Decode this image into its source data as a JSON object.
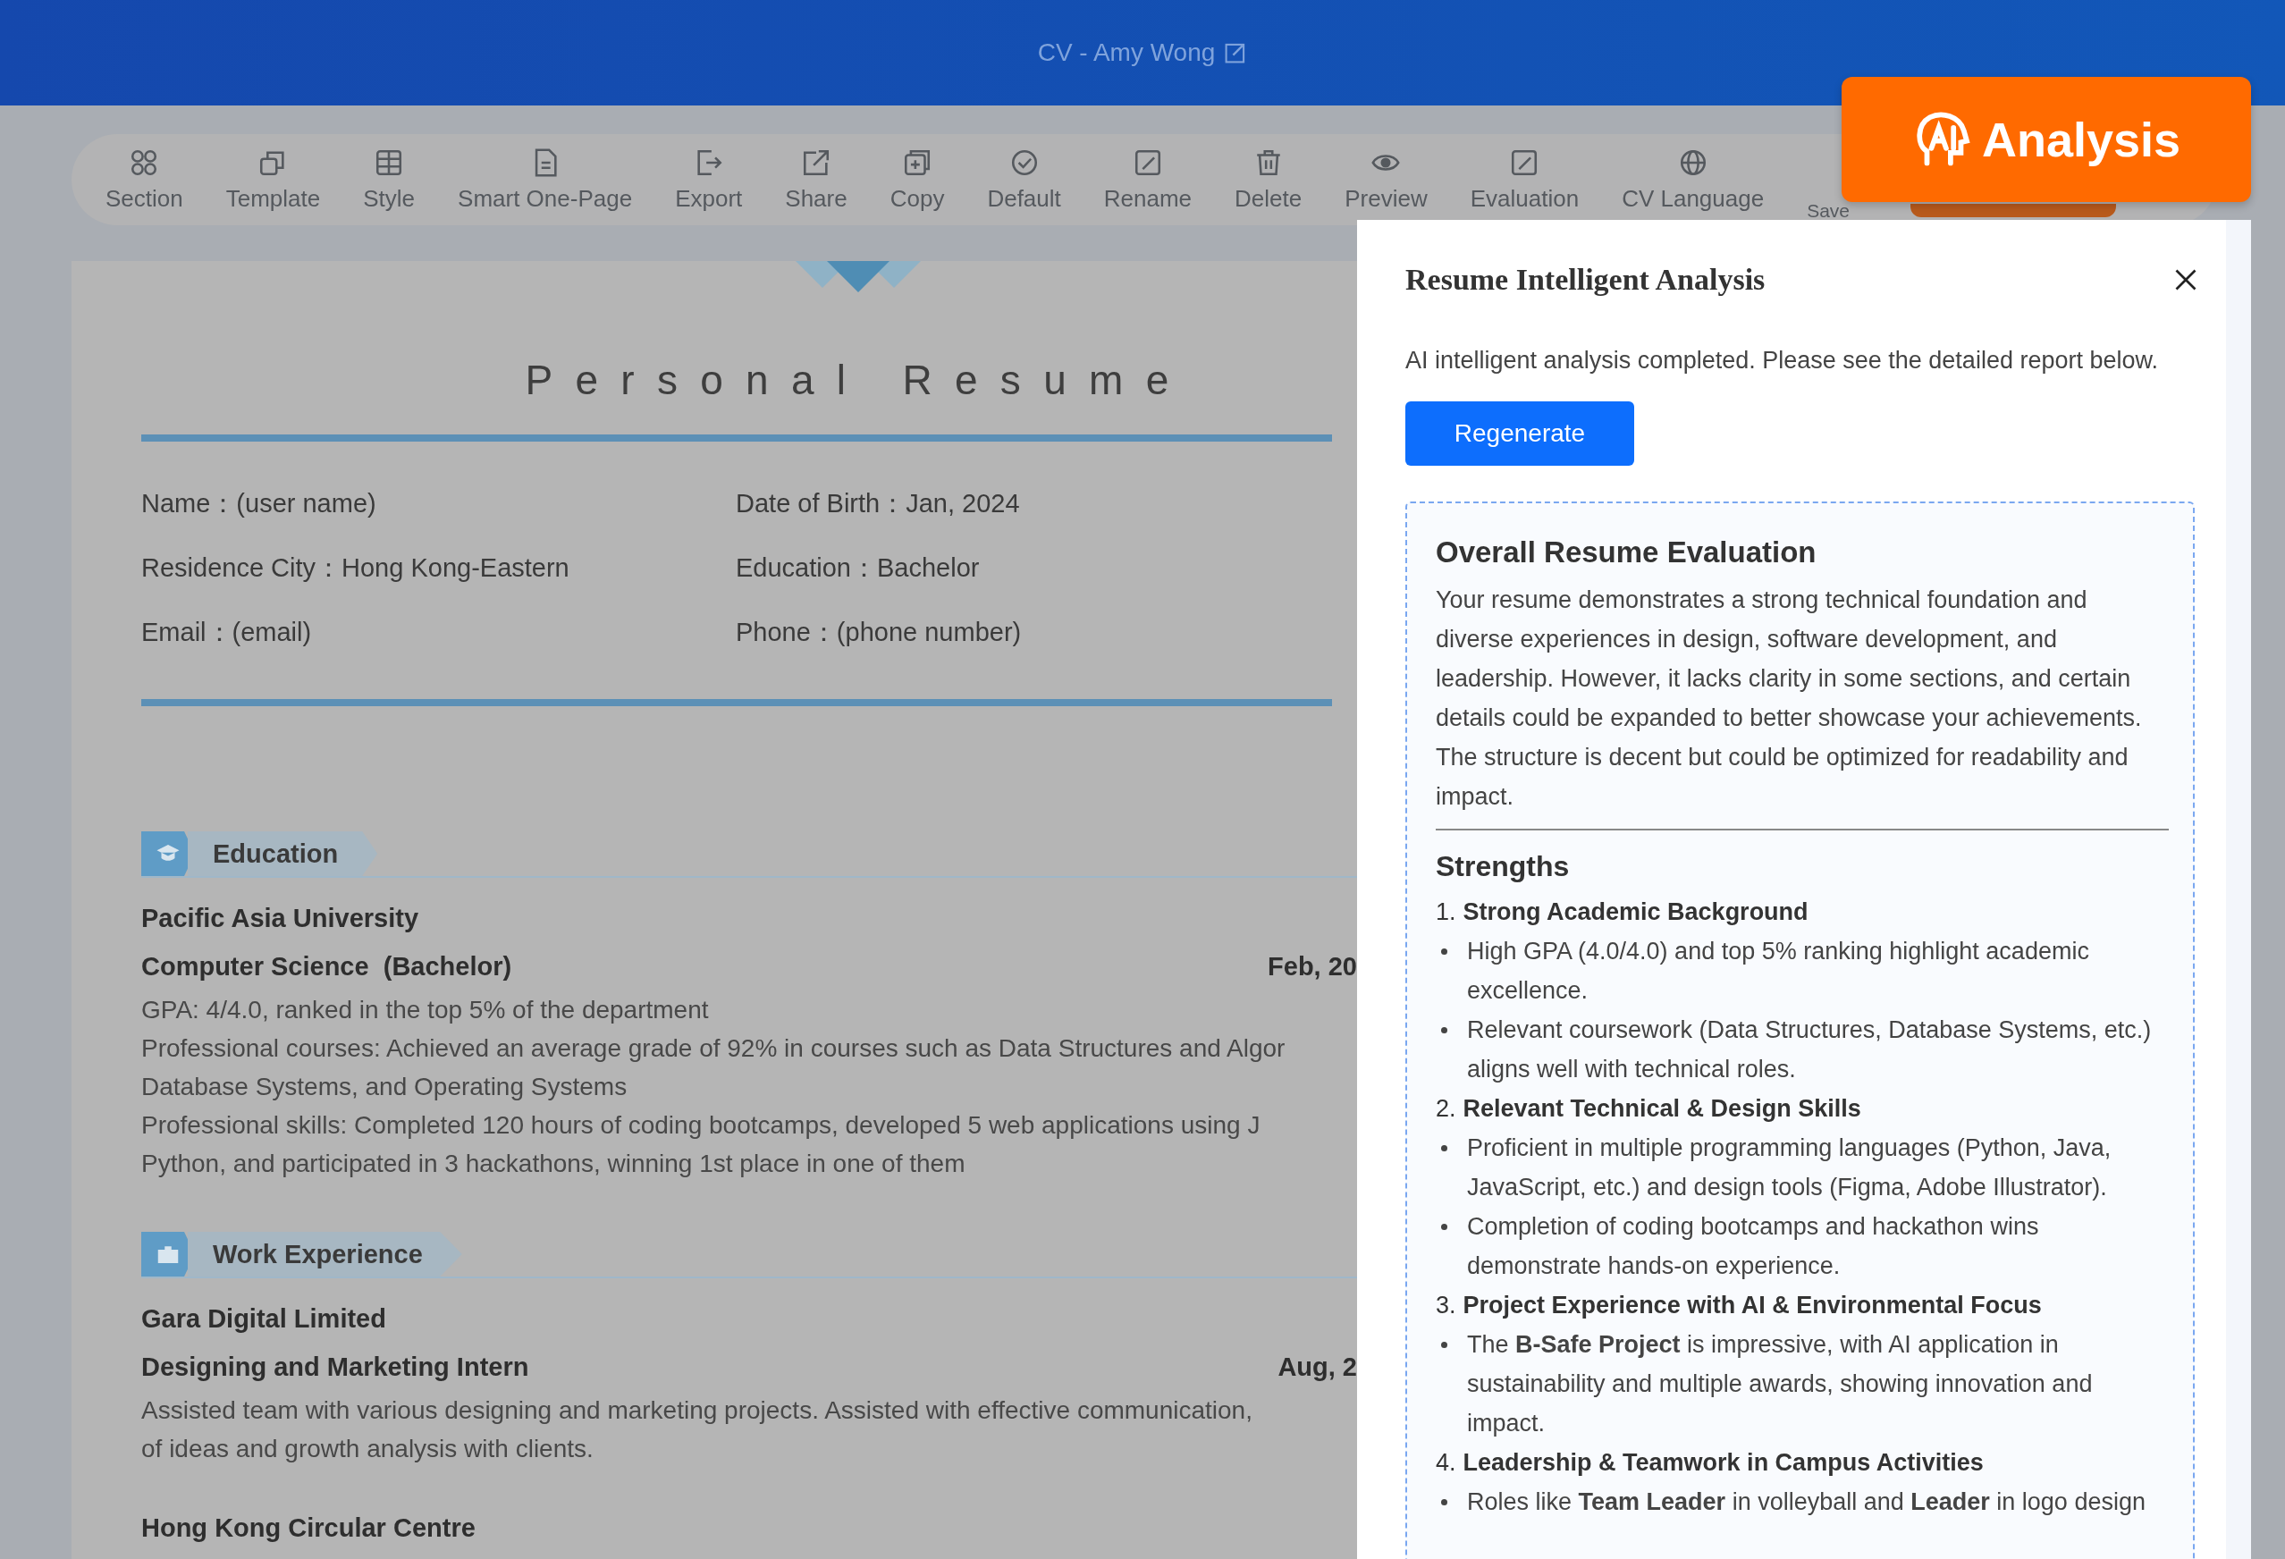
{
  "header": {
    "title": "CV - Amy Wong"
  },
  "toolbar": {
    "items": [
      {
        "label": "Section",
        "kind": "grid"
      },
      {
        "label": "Template",
        "kind": "stack"
      },
      {
        "label": "Style",
        "kind": "layout"
      },
      {
        "label": "Smart One-Page",
        "kind": "doc"
      },
      {
        "label": "Export",
        "kind": "export"
      },
      {
        "label": "Share",
        "kind": "share"
      },
      {
        "label": "Copy",
        "kind": "copy"
      },
      {
        "label": "Default",
        "kind": "check"
      },
      {
        "label": "Rename",
        "kind": "edit"
      },
      {
        "label": "Delete",
        "kind": "trash"
      },
      {
        "label": "Preview",
        "kind": "eye"
      },
      {
        "label": "Evaluation",
        "kind": "edit"
      },
      {
        "label": "CV Language",
        "kind": "globe"
      },
      {
        "label": "Save",
        "kind": "covered"
      }
    ]
  },
  "analysis_button": {
    "label": "Analysis"
  },
  "resume": {
    "title": "Personal Resume",
    "info": [
      {
        "text": "Name：(user name)"
      },
      {
        "text": "Date of Birth：Jan, 2024"
      },
      {
        "text": "Residence City：Hong Kong-Eastern"
      },
      {
        "text": "Education：Bachelor"
      },
      {
        "text": "Email：(email)"
      },
      {
        "text": "Phone：(phone number)"
      }
    ],
    "sections": [
      {
        "title": "Education",
        "kind": "education",
        "entries": [
          {
            "org": "Pacific Asia University",
            "role": "Computer Science  (Bachelor)",
            "date": "Feb, 20",
            "lines": [
              "GPA: 4/4.0, ranked in the top 5% of the department",
              "Professional courses: Achieved an average grade of 92% in courses such as Data Structures and Algor",
              "Database Systems, and Operating Systems",
              "Professional skills: Completed 120 hours of coding bootcamps, developed 5 web applications using J",
              "Python, and participated in 3 hackathons, winning 1st place in one of them"
            ]
          }
        ]
      },
      {
        "title": "Work Experience",
        "kind": "work",
        "entries": [
          {
            "org": "Gara Digital Limited",
            "role": "Designing and Marketing Intern",
            "date": "Aug, 2",
            "lines": [
              "Assisted team with various designing and marketing projects. Assisted with effective communication,",
              "of ideas and growth analysis with clients."
            ]
          },
          {
            "org": "Hong Kong Circular Centre"
          }
        ]
      }
    ]
  },
  "panel": {
    "title": "Resume Intelligent Analysis",
    "message": "AI intelligent analysis completed. Please see the detailed report below.",
    "button": "Regenerate",
    "report": {
      "heading": "Overall Resume Evaluation",
      "summary": "Your resume demonstrates a strong technical foundation and diverse experiences in design, software development, and leadership. However, it lacks clarity in some sections, and certain details could be expanded to better showcase your achievements. The structure is decent but could be optimized for readability and impact.",
      "strengths_heading": "Strengths",
      "strengths": [
        {
          "number": "1.",
          "title": "Strong Academic Background",
          "points": [
            "High GPA (4.0/4.0) and top 5% ranking highlight academic excellence.",
            "Relevant coursework (Data Structures, Database Systems, etc.) aligns well with technical roles."
          ]
        },
        {
          "number": "2.",
          "title": "Relevant Technical & Design Skills",
          "points": [
            "Proficient in multiple programming languages (Python, Java, JavaScript, etc.) and design tools (Figma, Adobe Illustrator).",
            "Completion of coding bootcamps and hackathon wins demonstrate hands-on experience."
          ]
        },
        {
          "number": "3.",
          "title": "Project Experience with AI & Environmental Focus",
          "points": [
            "The **B-Safe Project** is impressive, with AI application in sustainability and multiple awards, showing innovation and impact."
          ]
        },
        {
          "number": "4.",
          "title": "Leadership & Teamwork in Campus Activities",
          "points": [
            "Roles like **Team Leader** in volleyball and **Leader** in logo design"
          ]
        }
      ]
    }
  }
}
